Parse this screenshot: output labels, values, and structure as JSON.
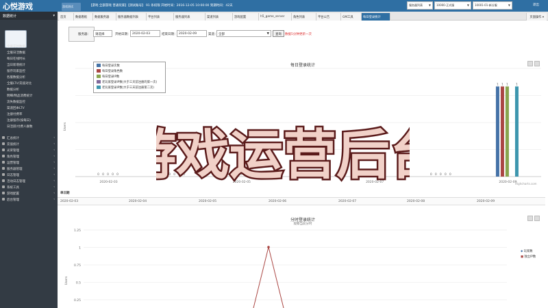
{
  "app": {
    "logo": "心悦游戏",
    "user_box": "游戏测试",
    "info_text": "【游戏 全部游戏 普通玩家】【测试账号】 91 条权限 开始时间：2016-12-05 10:00:00 到期时间：42天",
    "selectors": [
      {
        "value": "服务器列表"
      },
      {
        "value": "10000-正式服"
      },
      {
        "value": "10001-01-新分服"
      }
    ],
    "logout": "退出"
  },
  "sidebar": {
    "header": "数据统计",
    "sub_header": "数据统计",
    "items": [
      "全服实时数据",
      "全服日活数据",
      "每日在线时长",
      "当日新增统计",
      "留存玩家监控",
      "各服数据分析",
      "全服LTV/充值对比",
      "数据分析",
      "明细/物品消费统计",
      "流失数据监控",
      "渠道回本LTV",
      "注册付费率",
      "注册留存(按每日)",
      "日活跃/付费人群数"
    ],
    "menus": [
      "汇总统计",
      "充值统计",
      "光荣管理",
      "角色管理",
      "运营管理",
      "服务器管理",
      "日志管理",
      "活动日志管理",
      "系统工具",
      "游戏配置",
      "后台管理"
    ]
  },
  "tabs": [
    "首页",
    "数据看板",
    "数据服务器",
    "服务器数据列表",
    "平台列表",
    "服务器列表",
    "渠道列表",
    "游戏配置",
    "h5_game_server",
    "角色列表",
    "平台公告",
    "GM工具",
    "每日登录统计"
  ],
  "tab_active_index": 12,
  "page_ops": "页面操作",
  "filter": {
    "label_server": "服务器：",
    "server_value": "请选择",
    "label_start": "开始日期：",
    "start_value": "2020-02-03",
    "label_end": "结束日期：",
    "end_value": "2020-02-09",
    "label_channel": "渠道：",
    "channel_value": "全部",
    "query_button": "查询",
    "note": "数据5分钟更新一次"
  },
  "panel1": {
    "title": "每日登录统计",
    "credit": "Highcharts.com",
    "ylabel": "Users"
  },
  "chart_data": [
    {
      "type": "bar",
      "title": "每日登录统计",
      "ylabel": "Users",
      "categories": [
        "2020-02-03",
        "2020-02-04",
        "2020-02-05",
        "2020-02-06",
        "2020-02-07",
        "2020-02-08",
        "2020-02-09"
      ],
      "series": [
        {
          "name": "每日登录次数",
          "color": "#4572a7",
          "values": [
            0,
            0,
            0,
            0,
            0,
            0,
            1
          ]
        },
        {
          "name": "每日登录角色数",
          "color": "#aa4643",
          "values": [
            0,
            0,
            0,
            0,
            0,
            0,
            1
          ]
        },
        {
          "name": "每日登录IP数",
          "color": "#89a54e",
          "values": [
            0,
            0,
            0,
            0,
            0,
            0,
            1
          ]
        },
        {
          "name": "老玩家登录IP数(大于三天前注册的第一次)",
          "color": "#80699b",
          "values": [
            0,
            0,
            0,
            0,
            0,
            0,
            0
          ]
        },
        {
          "name": "老玩家登录IP数(大于三天前注册第二次)",
          "color": "#3d96ae",
          "values": [
            0,
            0,
            0,
            0,
            0,
            0,
            1
          ]
        }
      ],
      "legend": "top-left"
    },
    {
      "type": "line",
      "title": "分时登录统计",
      "subtitle": "观察当前分时",
      "ylabel": "Users",
      "yticks": [
        "1.25",
        "1",
        "0.75",
        "0.5",
        "0.25"
      ],
      "series": [
        {
          "name": "玩家数",
          "color": "#4572a7"
        },
        {
          "name": "独立IP数",
          "color": "#aa4643"
        }
      ]
    }
  ],
  "date_strip": {
    "label": "单日期",
    "dates": [
      "2020-02-03",
      "2020-02-04",
      "2020-02-05",
      "2020-02-06",
      "2020-02-07",
      "2020-02-08",
      "2020-02-09"
    ]
  },
  "watermark": {
    "text": "游戏运营后台"
  }
}
